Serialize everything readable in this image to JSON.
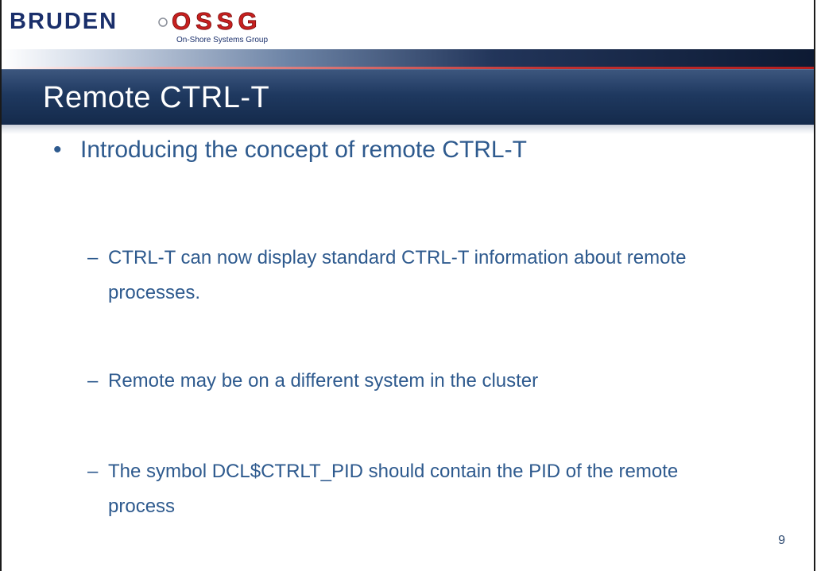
{
  "logo": {
    "brand_left": "BRUDEN",
    "brand_right": "OSSG",
    "tagline": "On-Shore Systems Group"
  },
  "slide": {
    "title": "Remote CTRL-T",
    "bullet": "Introducing the concept of remote CTRL-T",
    "sub_items": [
      "CTRL-T can now display standard CTRL-T information about remote processes.",
      "Remote may be on a different system in the cluster",
      "The symbol DCL$CTRLT_PID should contain the PID of the remote process"
    ],
    "page_number": "9"
  },
  "colors": {
    "title_bar": "#1f3960",
    "body_text": "#2e5a8e",
    "accent_red": "#c03030",
    "logo_blue": "#1a2f6b"
  }
}
